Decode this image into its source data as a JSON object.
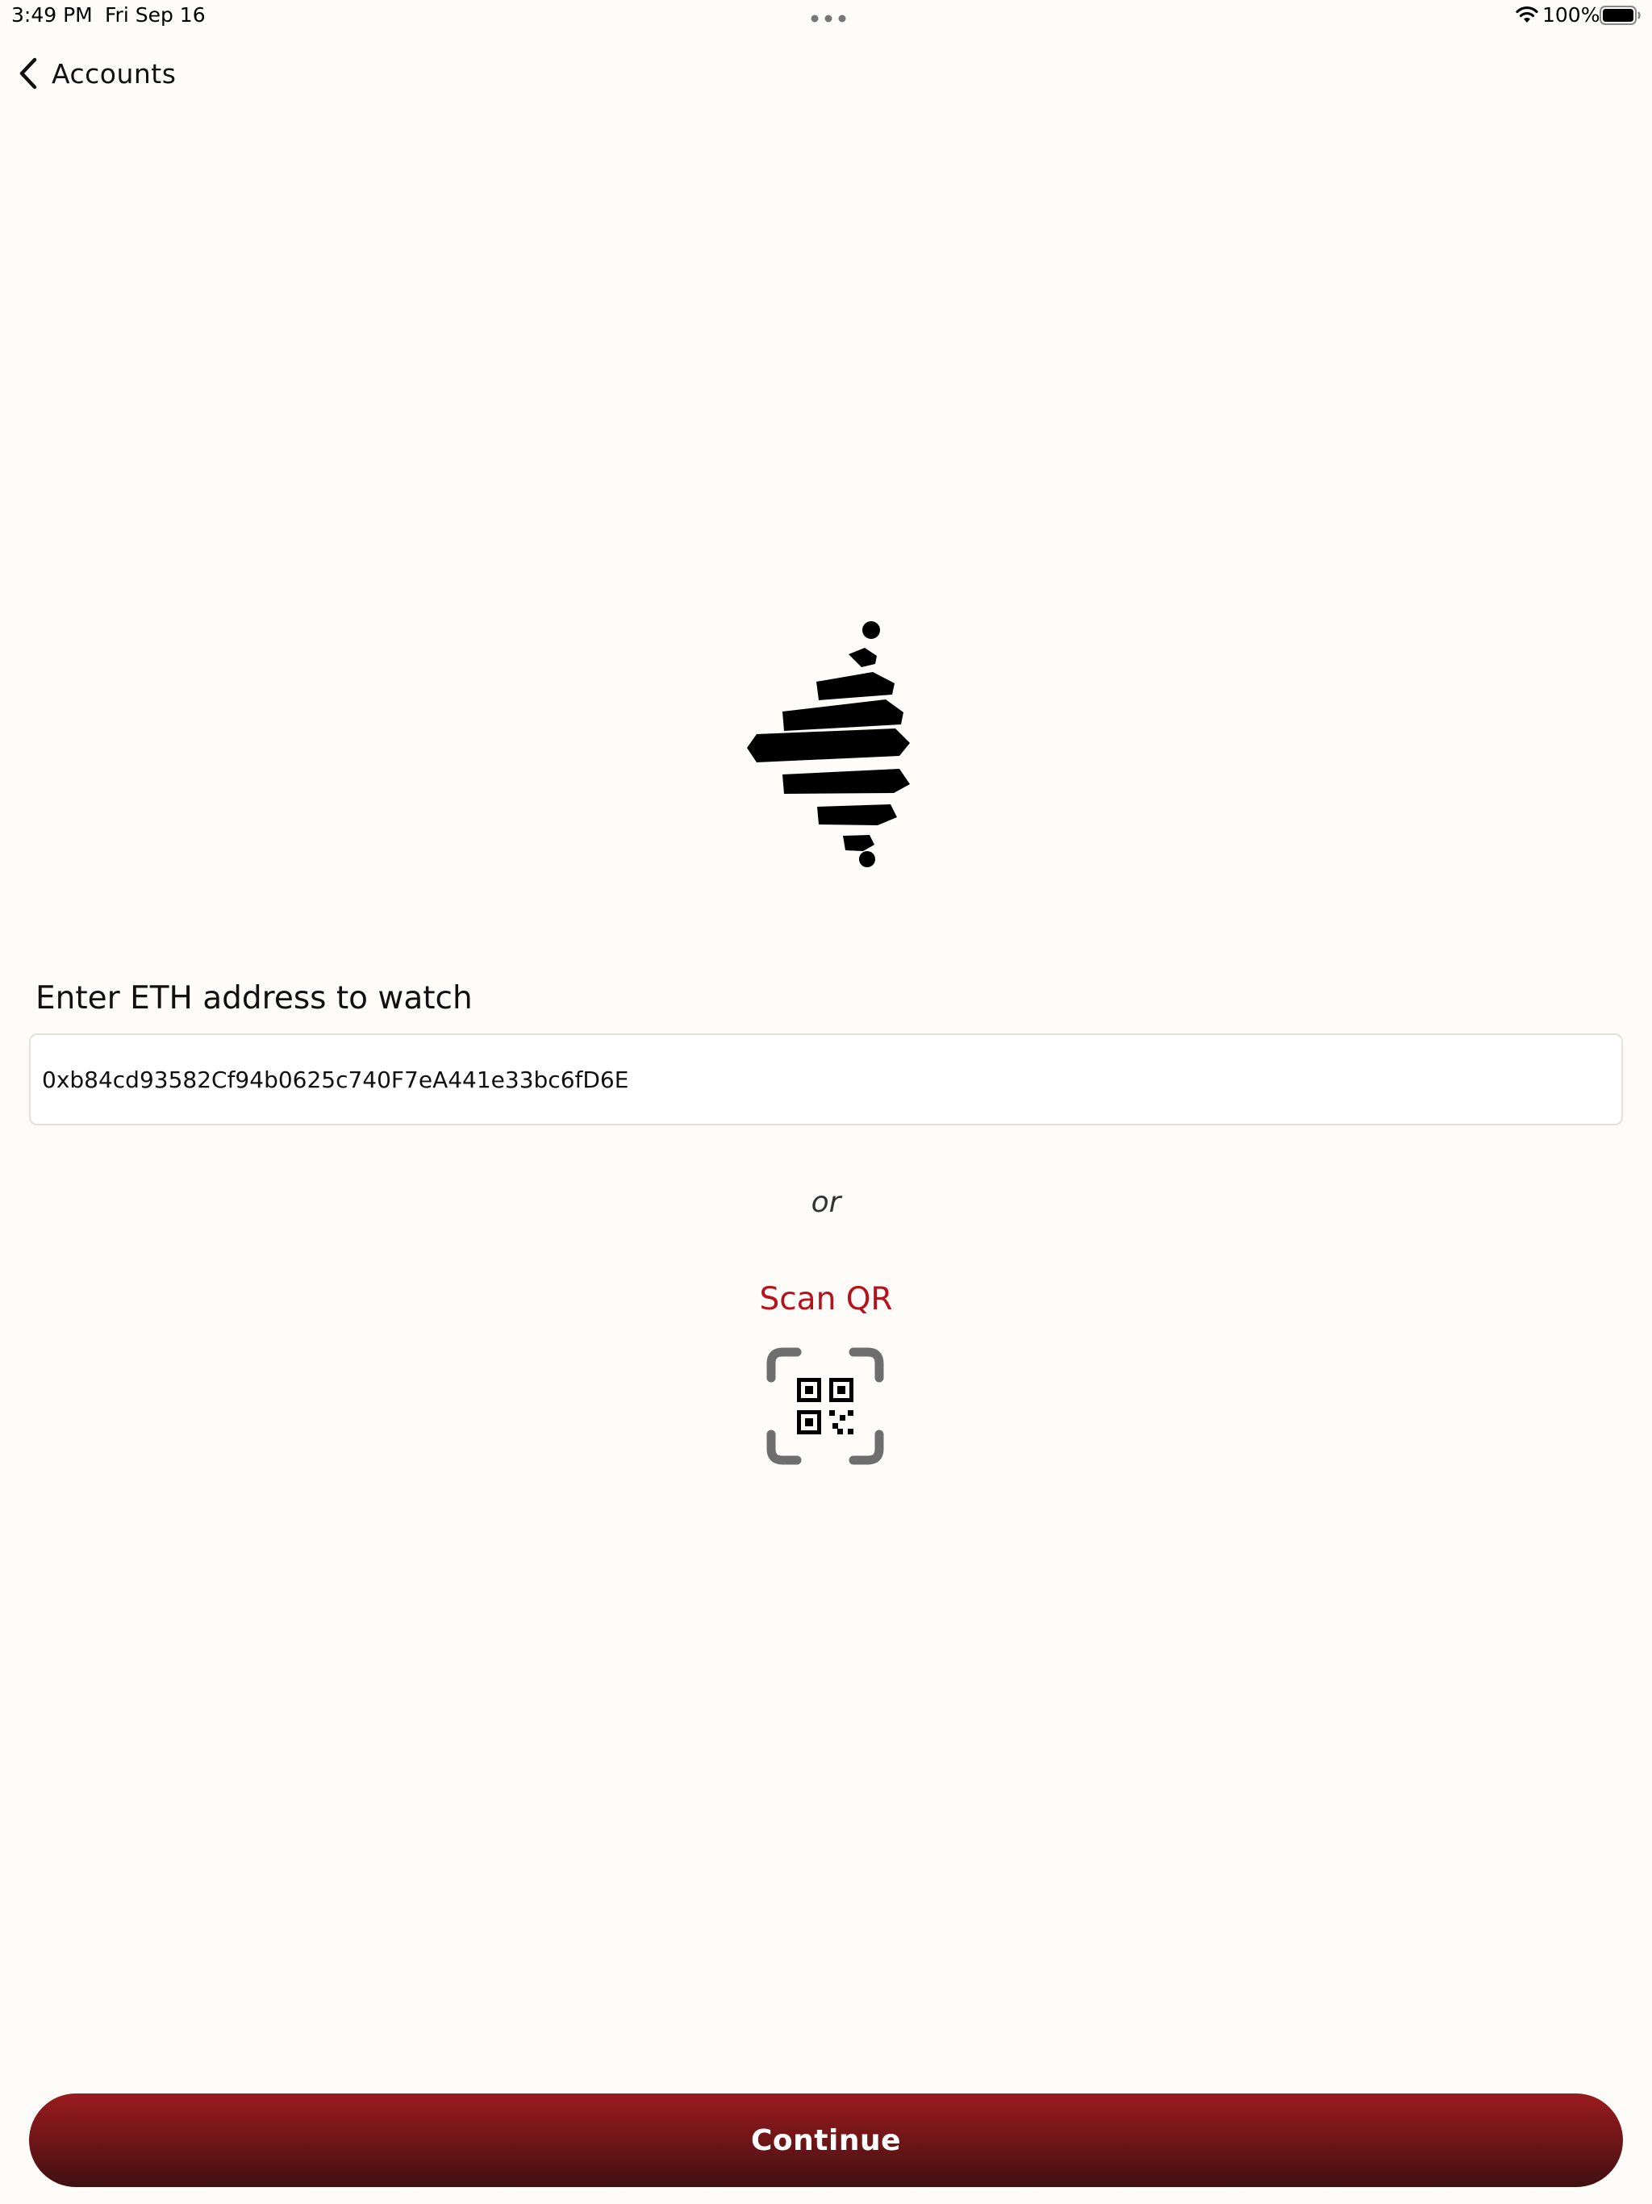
{
  "status_bar": {
    "time": "3:49 PM",
    "date": "Fri Sep 16",
    "battery_percent": "100%",
    "battery_level": 1.0,
    "icons": [
      "multitask-dots-icon",
      "wifi-icon",
      "battery-icon"
    ]
  },
  "nav": {
    "back_label": "Accounts",
    "back_icon": "chevron-left-icon"
  },
  "logo": {
    "icon": "brand-logo-icon"
  },
  "form": {
    "label": "Enter ETH address to watch",
    "address_value": "0xb84cd93582Cf94b0625c740F7eA441e33bc6fD6E",
    "or_text": "or",
    "scan_label": "Scan QR",
    "scan_icon": "qr-scan-icon"
  },
  "footer": {
    "continue_label": "Continue"
  },
  "colors": {
    "background": "#fdfcf9",
    "accent_red": "#b5121b",
    "button_top": "#9a1b1e",
    "button_bottom": "#3f1011",
    "text": "#111111"
  }
}
